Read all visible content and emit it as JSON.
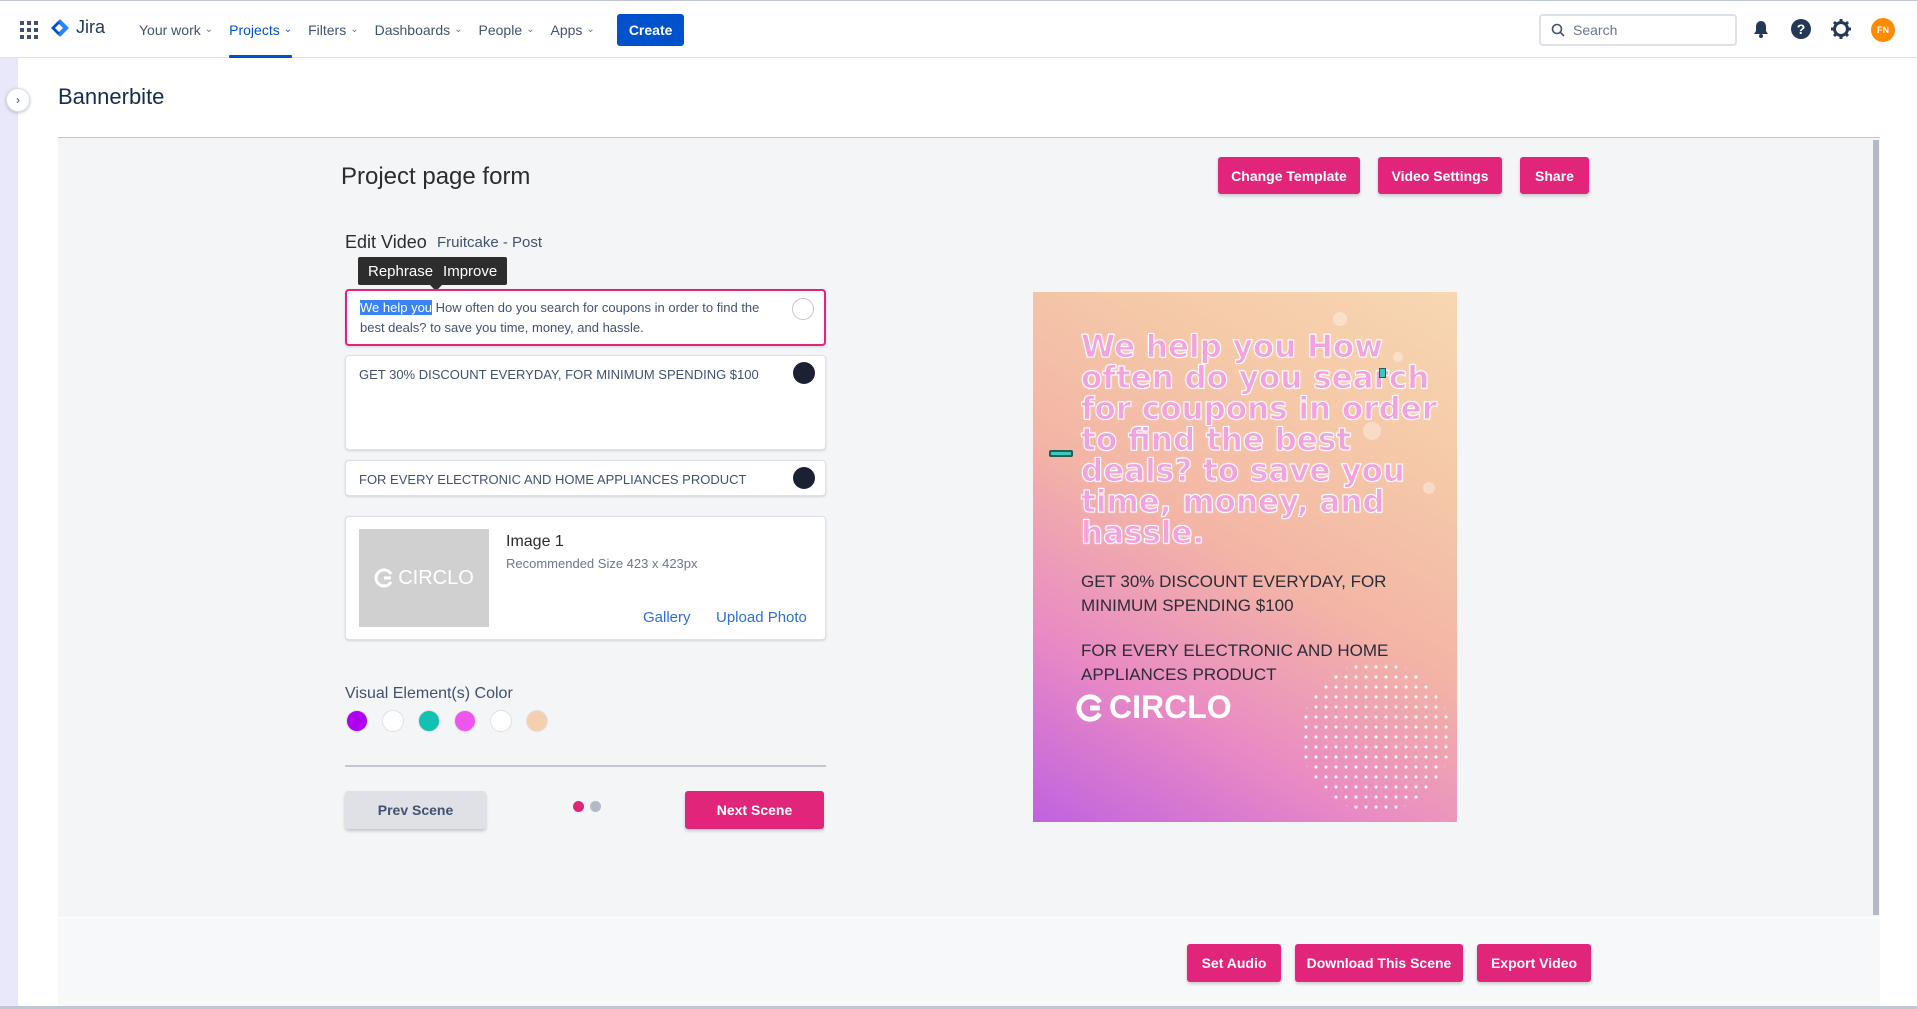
{
  "nav": {
    "logo": "Jira",
    "items": [
      {
        "label": "Your work"
      },
      {
        "label": "Projects"
      },
      {
        "label": "Filters"
      },
      {
        "label": "Dashboards"
      },
      {
        "label": "People"
      },
      {
        "label": "Apps"
      }
    ],
    "create": "Create",
    "search_placeholder": "Search",
    "avatar_initials": "FN"
  },
  "page": {
    "title": "Bannerbite"
  },
  "form": {
    "title": "Project page form",
    "buttons": {
      "change_template": "Change Template",
      "video_settings": "Video Settings",
      "share": "Share"
    },
    "edit_label": "Edit Video",
    "edit_sub": "Fruitcake - Post",
    "tooltip": {
      "rephrase": "Rephrase",
      "improve": "Improve"
    },
    "text1_selected": "We help you",
    "text1_rest": " How often do you search for coupons in order to find the best deals? to save you time, money, and hassle.",
    "text2": "GET 30% DISCOUNT EVERYDAY, FOR MINIMUM SPENDING $100",
    "text3": "FOR EVERY ELECTRONIC AND HOME APPLIANCES PRODUCT",
    "text_dot_colors": [
      "#ffffff",
      "#1c2033",
      "#1c2033"
    ],
    "image": {
      "logo_text": "CIRCLO",
      "title": "Image 1",
      "recommended": "Recommended Size 423 x 423px",
      "gallery": "Gallery",
      "upload": "Upload Photo"
    },
    "color_label": "Visual Element(s) Color",
    "colors": [
      "#b000f0",
      "#ffffff",
      "#12c2b0",
      "#ee55ee",
      "#ffffff",
      "#f5d0ae"
    ],
    "prev": "Prev Scene",
    "next": "Next Scene",
    "pager": {
      "total": 2,
      "active": 1
    }
  },
  "preview": {
    "headline": "We help you How often do you search for coupons in order to find the best deals? to save you time, money, and hassle.",
    "line1": "GET 30% DISCOUNT EVERYDAY, FOR MINIMUM SPENDING $100",
    "line2": "FOR EVERY ELECTRONIC AND HOME APPLIANCES PRODUCT",
    "logo": "CIRCLO"
  },
  "footer": {
    "set_audio": "Set Audio",
    "download": "Download This Scene",
    "export": "Export Video"
  },
  "colors": {
    "accent": "#e0257a",
    "jira_blue": "#0052cc"
  }
}
